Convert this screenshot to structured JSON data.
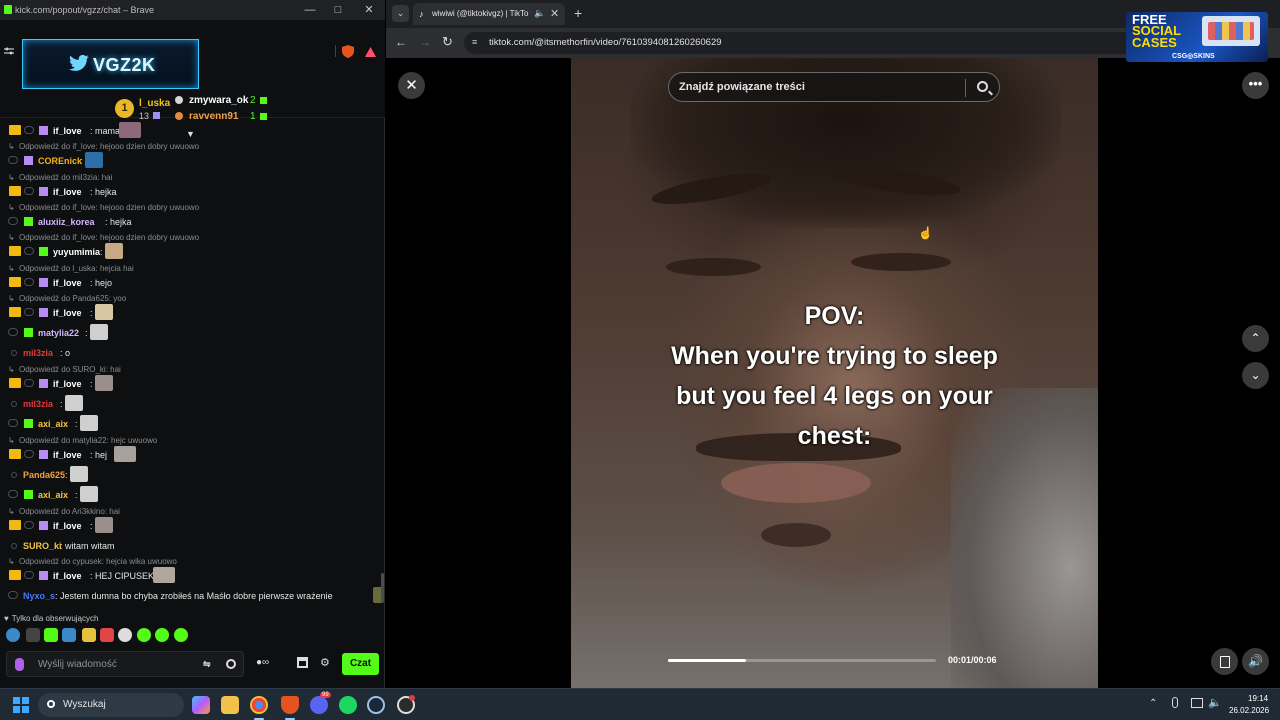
{
  "chat_window": {
    "title": "kick.com/popout/vgzz/chat – Brave",
    "channel_banner": "VGZ2K",
    "leaderboard": {
      "first": {
        "rank": "1",
        "name": "l_uska",
        "count": "13"
      },
      "second": {
        "name": "zmywara_ok",
        "count": "2"
      },
      "third": {
        "name": "ravvenn91",
        "count": "1"
      }
    },
    "messages": [
      {
        "type": "msg",
        "user": "if_love",
        "color": "#ffffff",
        "text": "mama",
        "emote": "#8c6a7a",
        "badges": "crown-gift"
      },
      {
        "type": "reply",
        "text": "Odpowiedź do if_love: hejooo dzien dobry uwuowo"
      },
      {
        "type": "msg",
        "user": "COREnick",
        "color": "#f5b31a",
        "text": "",
        "emote": "#2f6fa8",
        "badges": "ring-gift-purple"
      },
      {
        "type": "reply",
        "text": "Odpowiedź do mil3zia: hai"
      },
      {
        "type": "msg",
        "user": "if_love",
        "color": "#ffffff",
        "text": "hejka",
        "badges": "crown-gift"
      },
      {
        "type": "reply",
        "text": "Odpowiedź do if_love: hejooo dzien dobry uwuowo"
      },
      {
        "type": "msg",
        "user": "aluxiiz_korea",
        "color": "#d7b6ff",
        "text": "hejka",
        "badges": "ring-gift-green"
      },
      {
        "type": "reply",
        "text": "Odpowiedź do if_love: hejooo dzien dobry uwuowo"
      },
      {
        "type": "msg",
        "user": "yuyumimia",
        "color": "#ffffff",
        "text": "",
        "emote": "#c7a985",
        "badges": "crown-gift-green"
      },
      {
        "type": "reply",
        "text": "Odpowiedź do l_uska: hejcia hai"
      },
      {
        "type": "msg",
        "user": "if_love",
        "color": "#ffffff",
        "text": "hejo",
        "badges": "crown-gift"
      },
      {
        "type": "reply",
        "text": "Odpowiedź do Panda625: yoo"
      },
      {
        "type": "msg",
        "user": "if_love",
        "color": "#ffffff",
        "text": "",
        "emote": "#d9c8a4",
        "badges": "crown-gift"
      },
      {
        "type": "msg",
        "user": "matylia22",
        "color": "#d7b6ff",
        "text": "",
        "emote": "#cfcfcf",
        "badges": "ring-gift-green"
      },
      {
        "type": "msg",
        "user": "mil3zia",
        "color": "#e33a3a",
        "text": "o",
        "badges": "dot"
      },
      {
        "type": "reply",
        "text": "Odpowiedź do SURO_ki: hai"
      },
      {
        "type": "msg",
        "user": "if_love",
        "color": "#ffffff",
        "text": "",
        "emote": "#9a8f8a",
        "badges": "crown-gift"
      },
      {
        "type": "msg",
        "user": "mil3zia",
        "color": "#e33a3a",
        "text": "",
        "emote": "#cfcfcf",
        "badges": "dot"
      },
      {
        "type": "msg",
        "user": "axi_aix",
        "color": "#f5c542",
        "text": "",
        "emote": "#cfcfcf",
        "badges": "ring-gift-green"
      },
      {
        "type": "reply",
        "text": "Odpowiedź do matylia22: hejc uwuowo"
      },
      {
        "type": "msg",
        "user": "if_love",
        "color": "#ffffff",
        "text": "hej",
        "emote": "#a8a09a",
        "badges": "crown-gift"
      },
      {
        "type": "msg",
        "user": "Panda625",
        "color": "#f5a23a",
        "text": "",
        "emote": "#cfcfcf",
        "badges": "dot"
      },
      {
        "type": "msg",
        "user": "axi_aix",
        "color": "#f5c542",
        "text": "",
        "emote": "#cfcfcf",
        "badges": "ring-gift-green"
      },
      {
        "type": "reply",
        "text": "Odpowiedź do Ari3kkino: hai"
      },
      {
        "type": "msg",
        "user": "if_love",
        "color": "#ffffff",
        "text": "",
        "emote": "#9a8f8a",
        "badges": "crown-gift"
      },
      {
        "type": "msg",
        "user": "SURO_ki",
        "color": "#f5c542",
        "text": "witam witam",
        "badges": "dot"
      },
      {
        "type": "reply",
        "text": "Odpowiedź do cypusek: hejcia wika uwuowo"
      },
      {
        "type": "msg",
        "user": "if_love",
        "color": "#ffffff",
        "text": "HEJ CIPUSEK",
        "emote": "#b0a69e",
        "badges": "crown-gift"
      },
      {
        "type": "msg",
        "user": "Nyxo_s",
        "color": "#4a78ff",
        "text": "Jestem dumna bo chyba zrobiłeś na Maśło dobre pierwsze wrażenie",
        "emote": "#6b6a3a",
        "badges": "ring"
      }
    ],
    "followers_only": "Tylko dla obserwujących",
    "input_placeholder": "Wyślij wiadomość",
    "send_label": "Czat",
    "accent": "#53fc18"
  },
  "browser": {
    "tab_title": "wiwiwi (@tiktokivgz) | TikTo",
    "url": "tiktok.com/@itsmethorfin/video/7610394081260260629",
    "ad": {
      "line1": "FREE",
      "line2": "SOCIAL",
      "line3": "CASES",
      "brand": "CSG◎SKINS"
    },
    "search_placeholder": "Znajdź powiązane treści",
    "caption": [
      "POV:",
      "When you're trying to sleep",
      "but you feel 4 legs on your",
      "chest:"
    ],
    "video_time": "00:01/00:06",
    "progress_fraction": 0.29
  },
  "taskbar": {
    "search_label": "Wyszukaj",
    "time": "19:14",
    "date": "26.02.2026",
    "apps": [
      "copilot-icon",
      "file-explorer-icon",
      "chrome-icon",
      "brave-icon",
      "discord-icon",
      "spotify-icon",
      "steam-icon",
      "obs-icon"
    ],
    "discord_badge": "99"
  }
}
